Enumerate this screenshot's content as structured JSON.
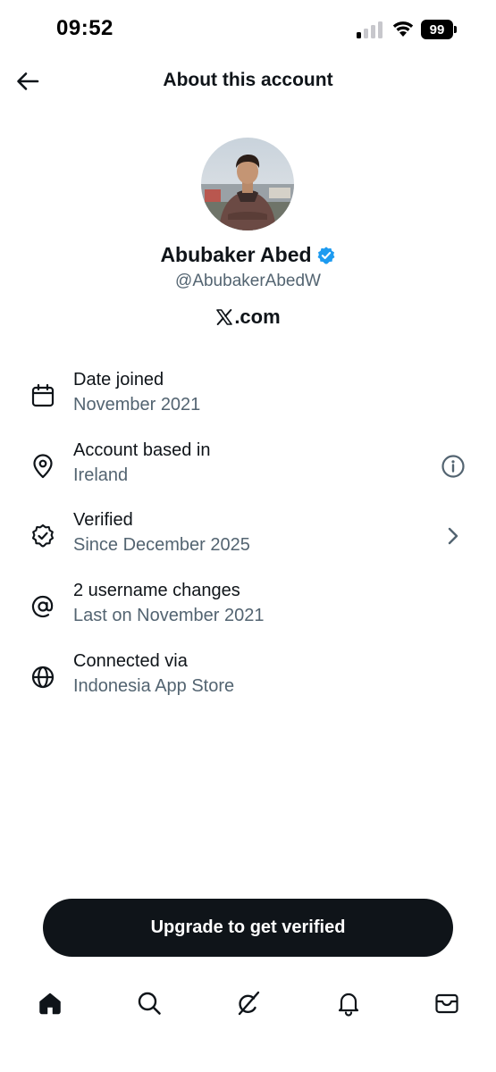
{
  "status_bar": {
    "time": "09:52",
    "battery": "99",
    "icons": [
      "signal-icon",
      "wifi-icon",
      "battery-icon"
    ]
  },
  "header": {
    "title": "About this account",
    "back_icon": "arrow-left-icon"
  },
  "profile": {
    "name": "Abubaker Abed",
    "handle": "@AbubakerAbedW",
    "site": ".com",
    "verified_color": "#1d9bf0"
  },
  "info": [
    {
      "icon": "calendar-icon",
      "title": "Date joined",
      "subtitle": "November 2021"
    },
    {
      "icon": "location-pin-icon",
      "title": "Account based in",
      "subtitle": "Ireland",
      "trail": "info-icon"
    },
    {
      "icon": "verified-badge-icon",
      "title": "Verified",
      "subtitle": "Since December 2025",
      "trail": "chevron-right-icon"
    },
    {
      "icon": "at-sign-icon",
      "title": "2 username changes",
      "subtitle": "Last on November 2021"
    },
    {
      "icon": "globe-icon",
      "title": "Connected via",
      "subtitle": "Indonesia App Store"
    }
  ],
  "upgrade_button": {
    "label": "Upgrade to get verified"
  },
  "bottom_nav": [
    "home-icon",
    "search-icon",
    "grok-icon",
    "notifications-bell-icon",
    "messages-envelope-icon"
  ],
  "colors": {
    "text_primary": "#0f1419",
    "text_secondary": "#536471",
    "accent_blue": "#1d9bf0",
    "button_bg": "#0f1419"
  }
}
